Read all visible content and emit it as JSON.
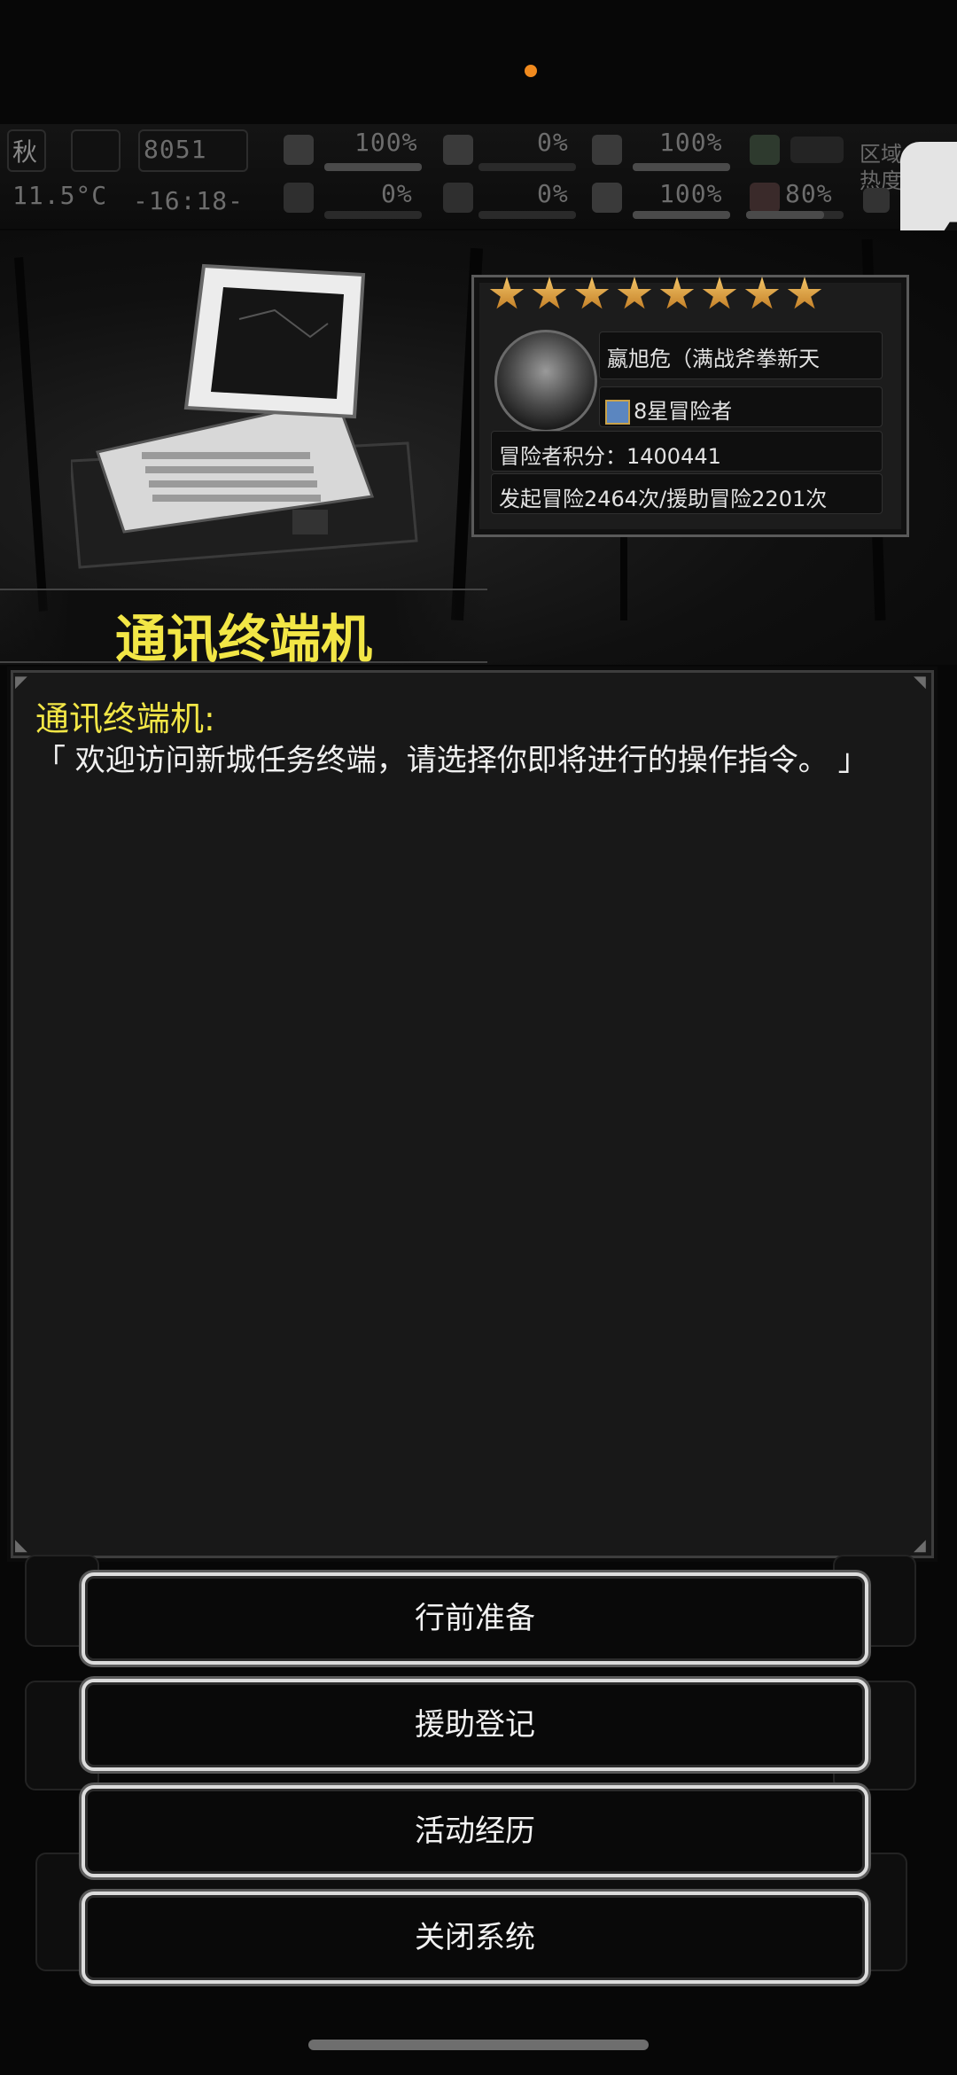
{
  "status_bar": {
    "season": "秋",
    "clock": "8051",
    "temperature": "11.5°C",
    "time_counter": "-16:18-",
    "gauges": [
      {
        "name": "health",
        "value": "100%"
      },
      {
        "name": "hunger",
        "value": "0%"
      },
      {
        "name": "armor",
        "value": "100%"
      },
      {
        "name": "bleeding",
        "value": "0%"
      },
      {
        "name": "thirst",
        "value": "0%"
      },
      {
        "name": "mood",
        "value": "100%"
      },
      {
        "name": "stamina",
        "value": "80%"
      }
    ],
    "region_label": "区域",
    "heat_label": "热度"
  },
  "side_tab": {
    "glyph": "❮"
  },
  "profile": {
    "stars": 8,
    "player_name": "嬴旭危（满战斧拳新天",
    "rank": "8星冒险者",
    "score_text": "冒险者积分：1400441",
    "adventure_stats": "发起冒险2464次/援助冒险2201次"
  },
  "page": {
    "title": "通讯终端机"
  },
  "dialog": {
    "speaker": "通讯终端机:",
    "message": "「 欢迎访问新城任务终端，请选择你即将进行的操作指令。 」"
  },
  "menu": {
    "prepare": "行前准备",
    "assist_register": "援助登记",
    "activity_history": "活动经历",
    "close_system": "关闭系统"
  },
  "colors": {
    "title_yellow": "#f2e646",
    "notification_dot": "#f08a1e",
    "star_gold": "#e3a643"
  }
}
